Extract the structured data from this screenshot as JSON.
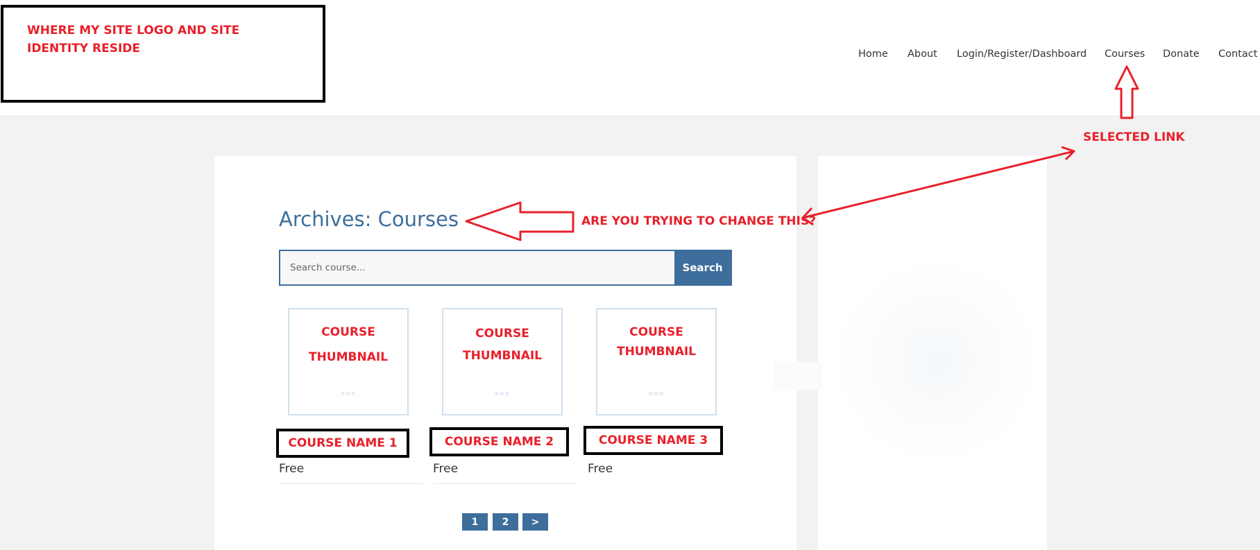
{
  "header": {
    "logo_note": "WHERE MY SITE LOGO AND SITE IDENTITY RESIDE",
    "nav": [
      {
        "label": "Home"
      },
      {
        "label": "About"
      },
      {
        "label": "Login/Register/Dashboard"
      },
      {
        "label": "Courses"
      },
      {
        "label": "Donate"
      },
      {
        "label": "Contact"
      }
    ]
  },
  "annotations": {
    "selected_link": "SELECTED LINK",
    "change_question": "ARE YOU TRYING TO CHANGE THIS?",
    "arrow_color": "#e8202a"
  },
  "main": {
    "title": "Archives: Courses",
    "search": {
      "placeholder": "Search course...",
      "button": "Search"
    },
    "courses": [
      {
        "thumb_line1": "COURSE",
        "thumb_line2": "THUMBNAIL",
        "name": "COURSE NAME 1",
        "price": "Free"
      },
      {
        "thumb_line1": "COURSE",
        "thumb_line2": "THUMBNAIL",
        "name": "COURSE NAME 2",
        "price": "Free"
      },
      {
        "thumb_line1": "COURSE",
        "thumb_line2": "THUMBNAIL",
        "name": "COURSE NAME 3",
        "price": "Free"
      }
    ],
    "pagination": [
      "1",
      "2",
      ">"
    ]
  },
  "colors": {
    "accent": "#3d6e9c",
    "background": "#f2f2f2",
    "annotation": "#e8202a"
  }
}
